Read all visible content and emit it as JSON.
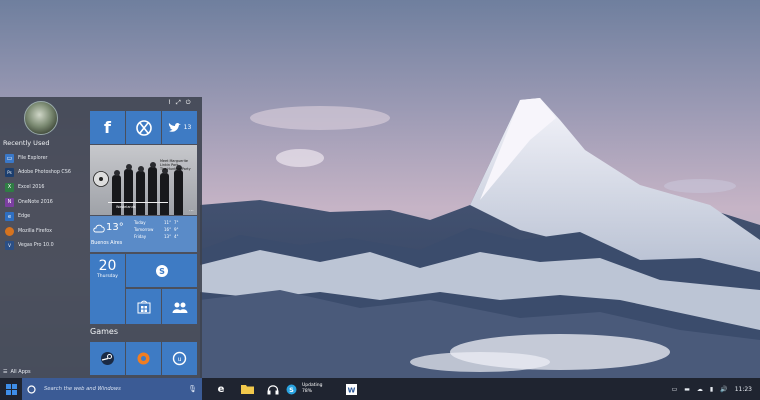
{
  "start_menu": {
    "section_title": "Recently Used",
    "apps": [
      {
        "label": "File Explorer",
        "icon": "folder-icon",
        "color": "#3a78c8"
      },
      {
        "label": "Adobe Photoshop CS6",
        "icon": "photoshop-icon",
        "color": "#1c3e6e"
      },
      {
        "label": "Excel 2016",
        "icon": "excel-icon",
        "color": "#2f7d44"
      },
      {
        "label": "OneNote 2016",
        "icon": "onenote-icon",
        "color": "#7b3fa0"
      },
      {
        "label": "Edge",
        "icon": "edge-icon",
        "color": "#2e6fc2"
      },
      {
        "label": "Mozilla Firefox",
        "icon": "firefox-icon",
        "color": "#d6731f"
      },
      {
        "label": "Vegas Pro 10.0",
        "icon": "vegas-icon",
        "color": "#2b4f86"
      }
    ],
    "all_apps_label": "All Apps",
    "games_label": "Games"
  },
  "tiles": {
    "twitter_count": "13",
    "music": {
      "line1": "Meet Marguerite",
      "line2": "Linkin Park",
      "line3": "The Hunting Party",
      "bottom": "Wastelands"
    },
    "weather": {
      "temp": "13°",
      "rows": [
        {
          "day": "Today",
          "hi": "11°",
          "lo": "7°"
        },
        {
          "day": "Tomorrow",
          "hi": "16°",
          "lo": "9°"
        },
        {
          "day": "Friday",
          "hi": "13°",
          "lo": "4°"
        }
      ],
      "city": "Buenos Aires"
    },
    "calendar_day": "20",
    "calendar_weekday": "Thursday"
  },
  "taskbar": {
    "search_placeholder": "Search the web and Windows",
    "updating_label": "Updating",
    "updating_percent": "78%",
    "clock": "11:23"
  },
  "colors": {
    "accent": "#3e7bc4",
    "taskbar": "#1f2430",
    "search": "#3b5b95"
  }
}
